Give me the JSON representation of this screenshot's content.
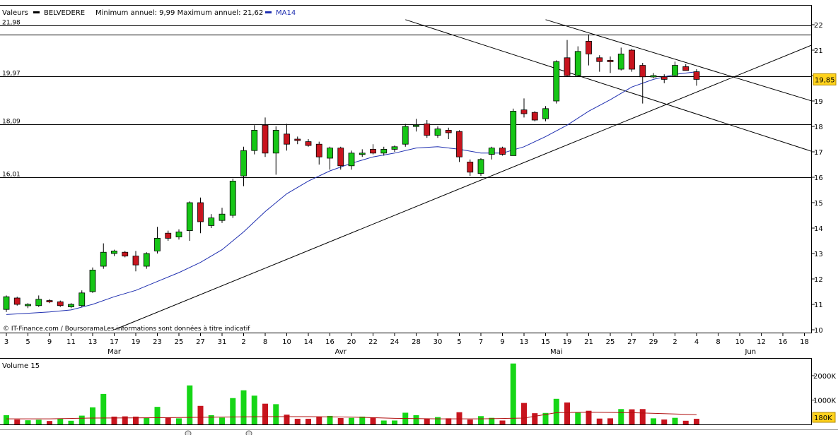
{
  "chart_data": [
    {
      "type": "candlestick",
      "header": {
        "label_valeurs": "Valeurs",
        "symbol": "BELVEDERE",
        "range_text": "Minimum annuel: 9,99 Maximum annuel: 21,62",
        "ma_label": "MA14"
      },
      "credit": "© IT-Finance.com / BoursoramaLes informations sont données à titre indicatif",
      "y_axis": {
        "min": 10,
        "max": 22,
        "ticks": [
          "10",
          "11",
          "12",
          "13",
          "14",
          "15",
          "16",
          "17",
          "18",
          "19",
          "20",
          "21",
          "22"
        ]
      },
      "x_axis": {
        "day_labels": [
          "3",
          "5",
          "9",
          "11",
          "13",
          "17",
          "19",
          "23",
          "25",
          "27",
          "31",
          "2",
          "8",
          "10",
          "14",
          "16",
          "20",
          "22",
          "24",
          "28",
          "30",
          "5",
          "7",
          "9",
          "13",
          "15",
          "19",
          "21",
          "25",
          "27",
          "29",
          "2",
          "4",
          "8",
          "10",
          "12",
          "16",
          "18"
        ],
        "month_labels": [
          {
            "label": "Mar",
            "index": 5
          },
          {
            "label": "Avr",
            "index": 15.5
          },
          {
            "label": "Mai",
            "index": 25.5
          },
          {
            "label": "Jun",
            "index": 34.5
          }
        ]
      },
      "horizontal_levels": [
        {
          "label": "21,98",
          "value": 21.98
        },
        {
          "label": "19,97",
          "value": 19.97
        },
        {
          "label": "18,09",
          "value": 18.09
        },
        {
          "label": "16,01",
          "value": 16.01
        }
      ],
      "extra_levels": [
        21.6
      ],
      "trend_lines": [
        {
          "x1": 5,
          "y1": 10,
          "x2": 38.5,
          "y2": 21.6
        },
        {
          "x1": 18.5,
          "y1": 22.2,
          "x2": 38.5,
          "y2": 16.7
        },
        {
          "x1": 25,
          "y1": 22.2,
          "x2": 38.5,
          "y2": 18.7
        }
      ],
      "last_price": {
        "label": "19,85",
        "value": 19.85
      },
      "candles": [
        {
          "i": 0,
          "o": 10.8,
          "h": 11.35,
          "l": 10.7,
          "c": 11.3
        },
        {
          "i": 0.5,
          "o": 11.25,
          "h": 11.3,
          "l": 10.95,
          "c": 11.0
        },
        {
          "i": 1,
          "o": 10.95,
          "h": 11.05,
          "l": 10.85,
          "c": 11.0
        },
        {
          "i": 1.5,
          "o": 10.95,
          "h": 11.35,
          "l": 10.9,
          "c": 11.2
        },
        {
          "i": 2,
          "o": 11.15,
          "h": 11.2,
          "l": 11.05,
          "c": 11.1
        },
        {
          "i": 2.5,
          "o": 11.1,
          "h": 11.15,
          "l": 10.9,
          "c": 10.95
        },
        {
          "i": 3,
          "o": 10.9,
          "h": 11.05,
          "l": 10.85,
          "c": 11.0
        },
        {
          "i": 3.5,
          "o": 10.95,
          "h": 11.55,
          "l": 10.9,
          "c": 11.45
        },
        {
          "i": 4,
          "o": 11.5,
          "h": 12.45,
          "l": 11.45,
          "c": 12.35
        },
        {
          "i": 4.5,
          "o": 12.5,
          "h": 13.4,
          "l": 12.4,
          "c": 13.05
        },
        {
          "i": 5,
          "o": 13.0,
          "h": 13.15,
          "l": 12.9,
          "c": 13.1
        },
        {
          "i": 5.5,
          "o": 13.05,
          "h": 13.1,
          "l": 12.85,
          "c": 12.9
        },
        {
          "i": 6,
          "o": 12.9,
          "h": 13.1,
          "l": 12.3,
          "c": 12.55
        },
        {
          "i": 6.5,
          "o": 12.5,
          "h": 13.05,
          "l": 12.4,
          "c": 13.0
        },
        {
          "i": 7,
          "o": 13.1,
          "h": 14.05,
          "l": 13.0,
          "c": 13.6
        },
        {
          "i": 7.5,
          "o": 13.8,
          "h": 13.9,
          "l": 13.5,
          "c": 13.6
        },
        {
          "i": 8,
          "o": 13.65,
          "h": 13.95,
          "l": 13.55,
          "c": 13.85
        },
        {
          "i": 8.5,
          "o": 13.9,
          "h": 15.05,
          "l": 13.5,
          "c": 15.0
        },
        {
          "i": 9,
          "o": 15.0,
          "h": 15.2,
          "l": 13.8,
          "c": 14.25
        },
        {
          "i": 9.5,
          "o": 14.1,
          "h": 14.55,
          "l": 14.0,
          "c": 14.4
        },
        {
          "i": 10,
          "o": 14.3,
          "h": 14.8,
          "l": 14.2,
          "c": 14.55
        },
        {
          "i": 10.5,
          "o": 14.5,
          "h": 15.95,
          "l": 14.4,
          "c": 15.85
        },
        {
          "i": 11,
          "o": 16.05,
          "h": 17.2,
          "l": 15.65,
          "c": 17.05
        },
        {
          "i": 11.5,
          "o": 17.05,
          "h": 18.05,
          "l": 16.9,
          "c": 17.85
        },
        {
          "i": 12,
          "o": 18.05,
          "h": 18.35,
          "l": 16.8,
          "c": 16.95
        },
        {
          "i": 12.5,
          "o": 16.95,
          "h": 18.0,
          "l": 16.1,
          "c": 17.85
        },
        {
          "i": 13,
          "o": 17.7,
          "h": 18.1,
          "l": 17.05,
          "c": 17.3
        },
        {
          "i": 13.5,
          "o": 17.5,
          "h": 17.6,
          "l": 17.3,
          "c": 17.45
        },
        {
          "i": 14,
          "o": 17.4,
          "h": 17.5,
          "l": 17.2,
          "c": 17.25
        },
        {
          "i": 14.5,
          "o": 17.3,
          "h": 17.4,
          "l": 16.5,
          "c": 16.8
        },
        {
          "i": 15,
          "o": 16.75,
          "h": 17.2,
          "l": 16.3,
          "c": 17.15
        },
        {
          "i": 15.5,
          "o": 17.15,
          "h": 17.2,
          "l": 16.3,
          "c": 16.45
        },
        {
          "i": 16,
          "o": 16.45,
          "h": 17.05,
          "l": 16.3,
          "c": 16.95
        },
        {
          "i": 16.5,
          "o": 16.95,
          "h": 17.1,
          "l": 16.8,
          "c": 16.95
        },
        {
          "i": 17,
          "o": 17.1,
          "h": 17.3,
          "l": 16.9,
          "c": 16.95
        },
        {
          "i": 17.5,
          "o": 16.95,
          "h": 17.2,
          "l": 16.85,
          "c": 17.1
        },
        {
          "i": 18,
          "o": 17.1,
          "h": 17.25,
          "l": 17.0,
          "c": 17.2
        },
        {
          "i": 18.5,
          "o": 17.3,
          "h": 18.1,
          "l": 17.2,
          "c": 18.0
        },
        {
          "i": 19,
          "o": 18.0,
          "h": 18.3,
          "l": 17.8,
          "c": 18.05
        },
        {
          "i": 19.5,
          "o": 18.1,
          "h": 18.25,
          "l": 17.55,
          "c": 17.65
        },
        {
          "i": 20,
          "o": 17.65,
          "h": 18.0,
          "l": 17.55,
          "c": 17.9
        },
        {
          "i": 20.5,
          "o": 17.85,
          "h": 17.95,
          "l": 17.5,
          "c": 17.75
        },
        {
          "i": 21,
          "o": 17.8,
          "h": 17.85,
          "l": 16.6,
          "c": 16.8
        },
        {
          "i": 21.5,
          "o": 16.6,
          "h": 16.7,
          "l": 16.05,
          "c": 16.2
        },
        {
          "i": 22,
          "o": 16.15,
          "h": 16.75,
          "l": 16.05,
          "c": 16.7
        },
        {
          "i": 22.5,
          "o": 16.9,
          "h": 17.2,
          "l": 16.7,
          "c": 17.15
        },
        {
          "i": 23,
          "o": 17.15,
          "h": 17.2,
          "l": 16.85,
          "c": 16.9
        },
        {
          "i": 23.5,
          "o": 16.85,
          "h": 18.7,
          "l": 16.85,
          "c": 18.6
        },
        {
          "i": 24,
          "o": 18.65,
          "h": 19.1,
          "l": 18.35,
          "c": 18.5
        },
        {
          "i": 24.5,
          "o": 18.55,
          "h": 18.6,
          "l": 18.2,
          "c": 18.25
        },
        {
          "i": 25,
          "o": 18.3,
          "h": 18.8,
          "l": 18.2,
          "c": 18.7
        },
        {
          "i": 25.5,
          "o": 19.0,
          "h": 20.6,
          "l": 18.9,
          "c": 20.55
        },
        {
          "i": 26,
          "o": 20.7,
          "h": 21.4,
          "l": 19.95,
          "c": 20.0
        },
        {
          "i": 26.5,
          "o": 20.0,
          "h": 21.15,
          "l": 19.95,
          "c": 20.95
        },
        {
          "i": 27,
          "o": 21.35,
          "h": 21.62,
          "l": 20.4,
          "c": 20.85
        },
        {
          "i": 27.5,
          "o": 20.7,
          "h": 20.8,
          "l": 20.15,
          "c": 20.55
        },
        {
          "i": 28,
          "o": 20.6,
          "h": 20.75,
          "l": 20.1,
          "c": 20.55
        },
        {
          "i": 28.5,
          "o": 20.25,
          "h": 21.1,
          "l": 20.2,
          "c": 20.85
        },
        {
          "i": 29,
          "o": 21.0,
          "h": 21.05,
          "l": 20.15,
          "c": 20.25
        },
        {
          "i": 29.5,
          "o": 20.4,
          "h": 20.5,
          "l": 18.9,
          "c": 19.95
        },
        {
          "i": 30,
          "o": 19.95,
          "h": 20.1,
          "l": 19.9,
          "c": 20.0
        },
        {
          "i": 30.5,
          "o": 19.95,
          "h": 20.05,
          "l": 19.7,
          "c": 19.85
        },
        {
          "i": 31,
          "o": 20.0,
          "h": 20.55,
          "l": 19.95,
          "c": 20.4
        },
        {
          "i": 31.5,
          "o": 20.35,
          "h": 20.45,
          "l": 20.2,
          "c": 20.2
        },
        {
          "i": 32,
          "o": 20.15,
          "h": 20.25,
          "l": 19.6,
          "c": 19.85
        }
      ],
      "ma14": [
        [
          0,
          10.6
        ],
        [
          1,
          10.65
        ],
        [
          2,
          10.7
        ],
        [
          3,
          10.78
        ],
        [
          4,
          11.0
        ],
        [
          5,
          11.3
        ],
        [
          6,
          11.55
        ],
        [
          7,
          11.9
        ],
        [
          8,
          12.25
        ],
        [
          9,
          12.65
        ],
        [
          10,
          13.15
        ],
        [
          11,
          13.85
        ],
        [
          12,
          14.65
        ],
        [
          13,
          15.35
        ],
        [
          14,
          15.85
        ],
        [
          15,
          16.25
        ],
        [
          16,
          16.55
        ],
        [
          17,
          16.8
        ],
        [
          18,
          16.95
        ],
        [
          19,
          17.15
        ],
        [
          20,
          17.2
        ],
        [
          21,
          17.1
        ],
        [
          22,
          16.95
        ],
        [
          23,
          16.95
        ],
        [
          24,
          17.2
        ],
        [
          25,
          17.6
        ],
        [
          26,
          18.05
        ],
        [
          27,
          18.6
        ],
        [
          28,
          19.05
        ],
        [
          29,
          19.55
        ],
        [
          30,
          19.85
        ],
        [
          31,
          20.05
        ],
        [
          32,
          20.15
        ]
      ],
      "volume": {
        "title": "Volume 15",
        "y_ticks": [
          {
            "label": "2000K",
            "value": 2000
          },
          {
            "label": "1000K",
            "value": 1000
          }
        ],
        "last_label": "180K",
        "ma_line": [
          [
            0,
            230
          ],
          [
            2,
            230
          ],
          [
            4,
            260
          ],
          [
            6,
            270
          ],
          [
            8,
            280
          ],
          [
            10,
            300
          ],
          [
            12,
            320
          ],
          [
            14,
            320
          ],
          [
            16,
            300
          ],
          [
            18,
            250
          ],
          [
            20,
            230
          ],
          [
            22,
            230
          ],
          [
            24,
            260
          ],
          [
            25.5,
            480
          ],
          [
            27,
            500
          ],
          [
            29,
            480
          ],
          [
            31,
            430
          ],
          [
            32,
            400
          ]
        ],
        "bars": [
          {
            "i": 0,
            "v": 380,
            "up": true
          },
          {
            "i": 0.5,
            "v": 200,
            "up": false
          },
          {
            "i": 1,
            "v": 170,
            "up": true
          },
          {
            "i": 1.5,
            "v": 190,
            "up": true
          },
          {
            "i": 2,
            "v": 140,
            "up": false
          },
          {
            "i": 2.5,
            "v": 230,
            "up": true
          },
          {
            "i": 3,
            "v": 150,
            "up": true
          },
          {
            "i": 3.5,
            "v": 360,
            "up": true
          },
          {
            "i": 4,
            "v": 700,
            "up": true
          },
          {
            "i": 4.5,
            "v": 1250,
            "up": true
          },
          {
            "i": 5,
            "v": 320,
            "up": false
          },
          {
            "i": 5.5,
            "v": 330,
            "up": false
          },
          {
            "i": 6,
            "v": 320,
            "up": false
          },
          {
            "i": 6.5,
            "v": 280,
            "up": true
          },
          {
            "i": 7,
            "v": 720,
            "up": true
          },
          {
            "i": 7.5,
            "v": 280,
            "up": false
          },
          {
            "i": 8,
            "v": 250,
            "up": true
          },
          {
            "i": 8.5,
            "v": 1600,
            "up": true
          },
          {
            "i": 9,
            "v": 760,
            "up": false
          },
          {
            "i": 9.5,
            "v": 380,
            "up": true
          },
          {
            "i": 10,
            "v": 280,
            "up": true
          },
          {
            "i": 10.5,
            "v": 1080,
            "up": true
          },
          {
            "i": 11,
            "v": 1400,
            "up": true
          },
          {
            "i": 11.5,
            "v": 1180,
            "up": true
          },
          {
            "i": 12,
            "v": 850,
            "up": false
          },
          {
            "i": 12.5,
            "v": 830,
            "up": true
          },
          {
            "i": 13,
            "v": 400,
            "up": false
          },
          {
            "i": 13.5,
            "v": 230,
            "up": false
          },
          {
            "i": 14,
            "v": 230,
            "up": false
          },
          {
            "i": 14.5,
            "v": 320,
            "up": false
          },
          {
            "i": 15,
            "v": 350,
            "up": true
          },
          {
            "i": 15.5,
            "v": 260,
            "up": false
          },
          {
            "i": 16,
            "v": 270,
            "up": true
          },
          {
            "i": 16.5,
            "v": 320,
            "up": true
          },
          {
            "i": 17,
            "v": 280,
            "up": false
          },
          {
            "i": 17.5,
            "v": 160,
            "up": true
          },
          {
            "i": 18,
            "v": 160,
            "up": true
          },
          {
            "i": 18.5,
            "v": 480,
            "up": true
          },
          {
            "i": 19,
            "v": 380,
            "up": true
          },
          {
            "i": 19.5,
            "v": 230,
            "up": false
          },
          {
            "i": 20,
            "v": 300,
            "up": true
          },
          {
            "i": 20.5,
            "v": 250,
            "up": false
          },
          {
            "i": 21,
            "v": 500,
            "up": false
          },
          {
            "i": 21.5,
            "v": 200,
            "up": false
          },
          {
            "i": 22,
            "v": 340,
            "up": true
          },
          {
            "i": 22.5,
            "v": 270,
            "up": true
          },
          {
            "i": 23,
            "v": 160,
            "up": false
          },
          {
            "i": 23.5,
            "v": 2500,
            "up": true
          },
          {
            "i": 24,
            "v": 880,
            "up": false
          },
          {
            "i": 24.5,
            "v": 460,
            "up": false
          },
          {
            "i": 25,
            "v": 470,
            "up": true
          },
          {
            "i": 25.5,
            "v": 1050,
            "up": true
          },
          {
            "i": 26,
            "v": 900,
            "up": false
          },
          {
            "i": 26.5,
            "v": 480,
            "up": true
          },
          {
            "i": 27,
            "v": 560,
            "up": false
          },
          {
            "i": 27.5,
            "v": 240,
            "up": false
          },
          {
            "i": 28,
            "v": 250,
            "up": false
          },
          {
            "i": 28.5,
            "v": 630,
            "up": true
          },
          {
            "i": 29,
            "v": 620,
            "up": false
          },
          {
            "i": 29.5,
            "v": 630,
            "up": false
          },
          {
            "i": 30,
            "v": 250,
            "up": true
          },
          {
            "i": 30.5,
            "v": 200,
            "up": false
          },
          {
            "i": 31,
            "v": 270,
            "up": true
          },
          {
            "i": 31.5,
            "v": 150,
            "up": false
          },
          {
            "i": 32,
            "v": 230,
            "up": false
          }
        ]
      }
    }
  ]
}
